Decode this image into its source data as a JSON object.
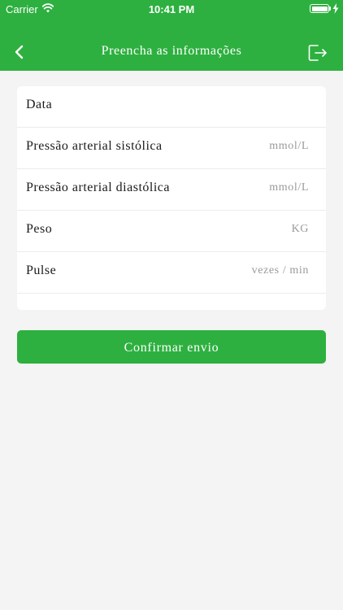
{
  "status_bar": {
    "carrier": "Carrier",
    "time": "10:41 PM",
    "battery_level": 1.0,
    "icons": [
      "wifi-icon",
      "battery-icon",
      "charging-bolt-icon"
    ]
  },
  "nav": {
    "title": "Preencha as informações",
    "back_icon": "chevron-left-icon",
    "exit_icon": "logout-icon"
  },
  "form": {
    "rows": [
      {
        "label": "Data",
        "unit": ""
      },
      {
        "label": "Pressão arterial sistólica",
        "unit": "mmol/L"
      },
      {
        "label": "Pressão arterial diastólica",
        "unit": "mmol/L"
      },
      {
        "label": "Peso",
        "unit": "KG"
      },
      {
        "label": "Pulse",
        "unit": "vezes / min"
      }
    ]
  },
  "actions": {
    "confirm_label": "Confirmar envio"
  },
  "colors": {
    "brand_green": "#2db03f",
    "background": "#f4f4f4",
    "card": "#ffffff",
    "unit_text": "#9a9a9a"
  }
}
